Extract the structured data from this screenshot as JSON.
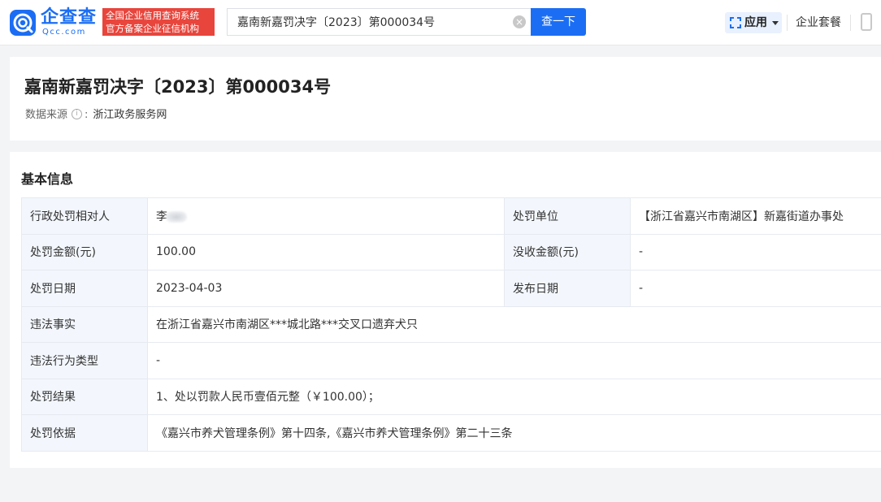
{
  "header": {
    "logo": {
      "name": "企查查",
      "domain": "Qcc.com"
    },
    "badge": {
      "line1": "全国企业信用查询系统",
      "line2": "官方备案企业征信机构"
    },
    "search": {
      "value": "嘉南新嘉罚决字〔2023〕第000034号",
      "button_label": "查一下"
    },
    "app_label": "应用",
    "suite_label": "企业套餐"
  },
  "page": {
    "title": "嘉南新嘉罚决字〔2023〕第000034号",
    "source_label": "数据来源",
    "source_value": "浙江政务服务网"
  },
  "basic_info": {
    "section_title": "基本信息",
    "rows": [
      {
        "label": "行政处罚相对人",
        "value": "李",
        "label2": "处罚单位",
        "value2": "【浙江省嘉兴市南湖区】新嘉街道办事处"
      },
      {
        "label": "处罚金额(元)",
        "value": "100.00",
        "label2": "没收金额(元)",
        "value2": "-"
      },
      {
        "label": "处罚日期",
        "value": "2023-04-03",
        "label2": "发布日期",
        "value2": "-"
      },
      {
        "label": "违法事实",
        "value": "在浙江省嘉兴市南湖区***城北路***交叉口遗弃犬只"
      },
      {
        "label": "违法行为类型",
        "value": "-"
      },
      {
        "label": "处罚结果",
        "value": "1、处以罚款人民币壹佰元整（￥100.00）；"
      },
      {
        "label": "处罚依据",
        "value": "《嘉兴市养犬管理条例》第十四条,《嘉兴市养犬管理条例》第二十三条"
      }
    ]
  },
  "colors": {
    "brand": "#1b6ef3",
    "badge": "#e8453c",
    "label_bg": "#f3f7fd"
  }
}
